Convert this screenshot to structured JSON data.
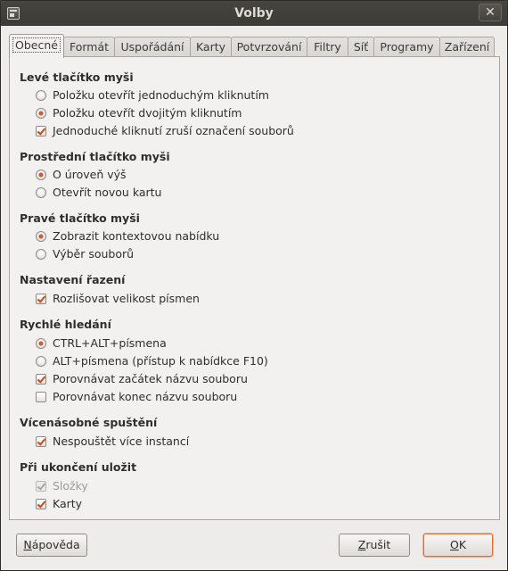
{
  "window": {
    "title": "Volby",
    "close_glyph": "✕",
    "icon": "app-window-icon"
  },
  "tabs": [
    {
      "label": "Obecné",
      "active": true
    },
    {
      "label": "Formát"
    },
    {
      "label": "Uspořádání"
    },
    {
      "label": "Karty"
    },
    {
      "label": "Potvrzování"
    },
    {
      "label": "Filtry"
    },
    {
      "label": "Síť"
    },
    {
      "label": "Programy"
    },
    {
      "label": "Zařízení"
    }
  ],
  "sections": {
    "left_mouse": {
      "title": "Levé tlačítko myši",
      "opt1": "Položku otevřít jednoduchým kliknutím",
      "opt2": "Položku otevřít dvojitým kliknutím",
      "opt3": "Jednoduché kliknutí zruší označení souborů"
    },
    "middle_mouse": {
      "title": "Prostřední tlačítko myši",
      "opt1": "O úroveň výš",
      "opt2": "Otevřít novou kartu"
    },
    "right_mouse": {
      "title": "Pravé tlačítko myši",
      "opt1": "Zobrazit kontextovou nabídku",
      "opt2": "Výběr souborů"
    },
    "sorting": {
      "title": "Nastavení řazení",
      "opt1": "Rozlišovat velikost písmen"
    },
    "quick_search": {
      "title": "Rychlé hledání",
      "opt1": "CTRL+ALT+písmena",
      "opt2": "ALT+písmena (přístup k nabídkce F10)",
      "opt3": "Porovnávat začátek názvu souboru",
      "opt4": "Porovnávat konec názvu souboru"
    },
    "multi_run": {
      "title": "Vícenásobné spuštění",
      "opt1": "Nespouštět více instancí"
    },
    "on_exit": {
      "title": "Při ukončení uložit",
      "opt1": "Složky",
      "opt2": "Karty"
    }
  },
  "buttons": {
    "help_u": "N",
    "help_rest": "ápověda",
    "cancel_u": "Z",
    "cancel_rest": "rušit",
    "ok_u": "O",
    "ok_rest": "K"
  },
  "colors": {
    "accent": "#e0592a",
    "titlebar": "#3c3b37",
    "window_bg": "#edeceb"
  }
}
